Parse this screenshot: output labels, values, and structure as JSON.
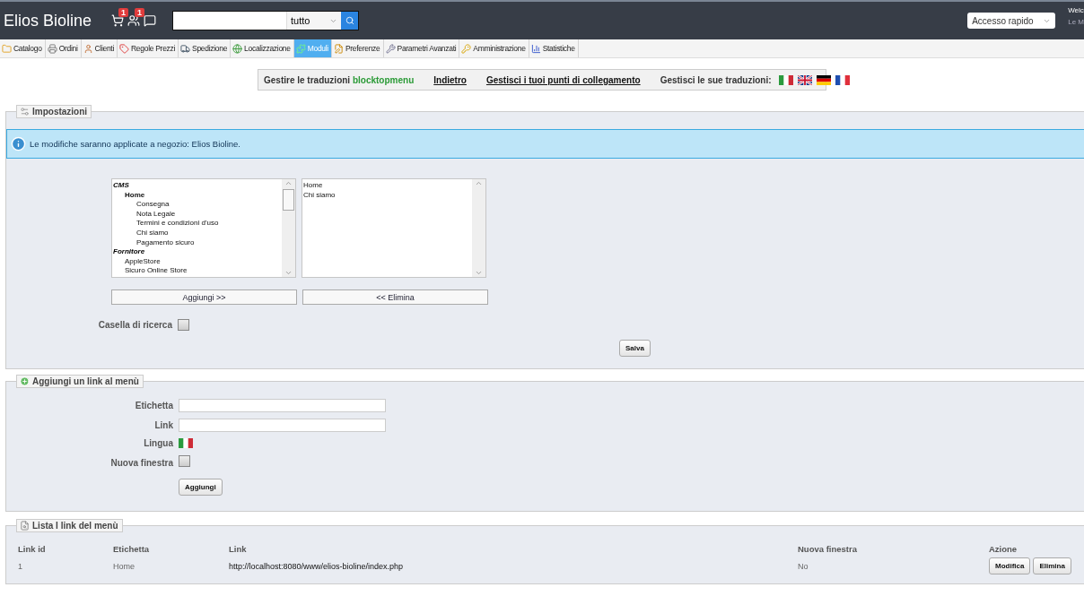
{
  "header": {
    "shop_name": "Elios Bioline",
    "notifications": [
      {
        "kind": "cart",
        "badge": "1"
      },
      {
        "kind": "customers",
        "badge": "1"
      },
      {
        "kind": "messages"
      }
    ],
    "search": {
      "scope": "tutto"
    },
    "quick_access": "Accesso rapido",
    "user_lines": [
      "Welc",
      "Le M"
    ]
  },
  "tabs": [
    {
      "label": "Catalogo",
      "selected": false
    },
    {
      "label": "Ordini",
      "selected": false
    },
    {
      "label": "Clienti",
      "selected": false
    },
    {
      "label": "Regole Prezzi",
      "selected": false
    },
    {
      "label": "Spedizione",
      "selected": false
    },
    {
      "label": "Localizzazione",
      "selected": false
    },
    {
      "label": "Moduli",
      "selected": true
    },
    {
      "label": "Preferenze",
      "selected": false
    },
    {
      "label": "Parametri Avanzati",
      "selected": false
    },
    {
      "label": "Amministrazione",
      "selected": false
    },
    {
      "label": "Statistiche",
      "selected": false
    }
  ],
  "translation_bar": {
    "label": "Gestire le traduzioni",
    "module": "blocktopmenu",
    "links": [
      "Indietro",
      "Gestisci i tuoi punti di collegamento"
    ],
    "languages_label": "Gestisci le sue traduzioni:",
    "flags": [
      {
        "kind": "it"
      },
      {
        "kind": "gb"
      },
      {
        "kind": "de"
      },
      {
        "kind": "fr"
      }
    ]
  },
  "settings": {
    "legend": "Impostazioni",
    "info": "Le modifiche saranno applicate a negozio: Elios Bioline.",
    "available": [
      {
        "label": "CMS",
        "kind": "group",
        "children": [
          {
            "label": "Home",
            "kind": "category",
            "children": [
              {
                "label": "Consegna",
                "kind": "page"
              },
              {
                "label": "Nota Legale",
                "kind": "page"
              },
              {
                "label": "Termini e condizioni d'uso",
                "kind": "page"
              },
              {
                "label": "Chi siamo",
                "kind": "page"
              },
              {
                "label": "Pagamento sicuro",
                "kind": "page"
              }
            ]
          }
        ]
      },
      {
        "label": "Fornitore",
        "kind": "group",
        "children": [
          {
            "label": "AppleStore",
            "kind": "page"
          },
          {
            "label": "Sicuro Online Store",
            "kind": "page"
          }
        ]
      }
    ],
    "selected_items": [
      "Home",
      "Chi siamo"
    ],
    "add_button": "Aggiungi >>",
    "remove_button": "<< Elimina",
    "search_box_label": "Casella di ricerca",
    "search_box_checked": false,
    "save_button": "Salva"
  },
  "add_link": {
    "legend": "Aggiungi un link al menù",
    "fields": [
      {
        "label": "Etichetta",
        "kind": "text"
      },
      {
        "label": "Link",
        "kind": "text"
      },
      {
        "label": "Lingua",
        "kind": "flag"
      },
      {
        "label": "Nuova finestra",
        "kind": "checkbox",
        "checked": false
      }
    ],
    "button": "Aggiungi"
  },
  "link_list": {
    "legend": "Lista I link del menù",
    "columns": [
      "Link id",
      "Etichetta",
      "Link",
      "Nuova finestra",
      "Azione"
    ],
    "rows": [
      {
        "cells": [
          "1",
          "Home",
          "http://localhost:8080/www/elios-bioline/index.php",
          "No"
        ],
        "actions": [
          "Modifica",
          "Elimina"
        ]
      }
    ]
  }
}
